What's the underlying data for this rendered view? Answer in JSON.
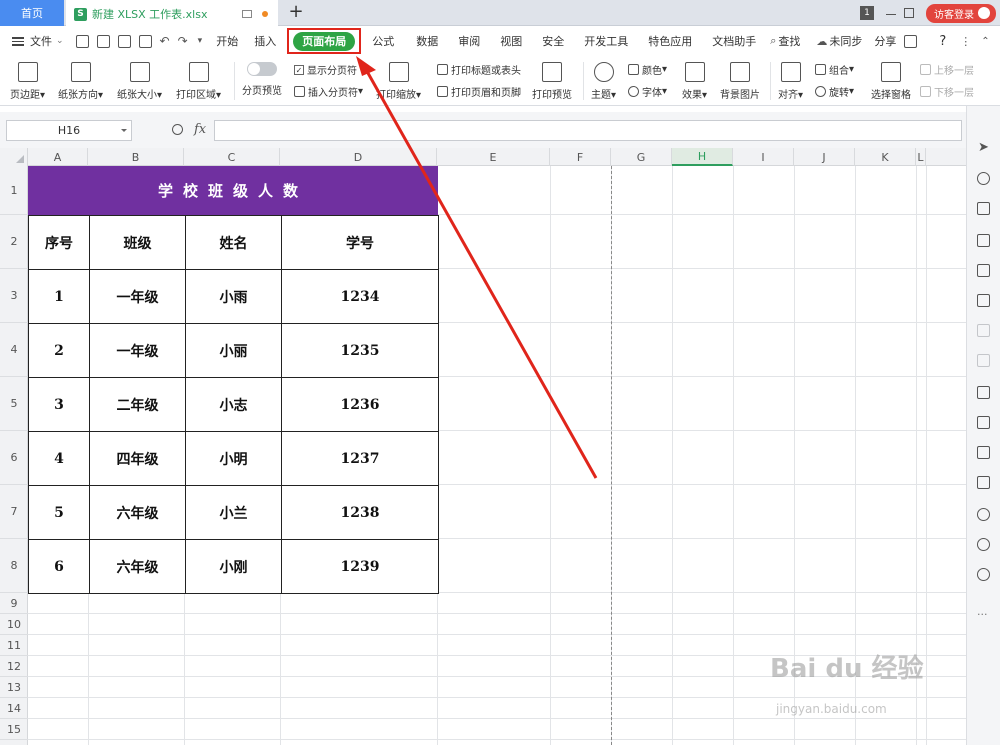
{
  "tabs": {
    "home": "首页",
    "file_icon": "S",
    "file_name": "新建 XLSX 工作表.xlsx",
    "add": "+",
    "window_count": "1",
    "login": "访客登录"
  },
  "menu": {
    "file": "文件",
    "items": [
      "开始",
      "插入",
      "页面布局",
      "公式",
      "数据",
      "审阅",
      "视图",
      "安全",
      "开发工具",
      "特色应用",
      "文档助手"
    ],
    "active": "页面布局",
    "search": "查找",
    "sync": "未同步",
    "share": "分享",
    "help": "?"
  },
  "ribbon": {
    "margins": "页边距",
    "orientation": "纸张方向",
    "size": "纸张大小",
    "print_area": "打印区域",
    "page_break_preview": "分页预览",
    "show_page_break": "显示分页符",
    "insert_page_break": "插入分页符",
    "print_scaling": "打印缩放",
    "print_titles": "打印标题或表头",
    "print_header_footer": "打印页眉和页脚",
    "print_preview": "打印预览",
    "theme": "主题",
    "colors": "颜色",
    "fonts": "字体",
    "effects": "效果",
    "background": "背景图片",
    "align": "对齐",
    "group": "组合",
    "rotate": "旋转",
    "selection_pane": "选择窗格",
    "bring_forward": "上移一层",
    "send_backward": "下移一层"
  },
  "formula": {
    "cell_ref": "H16",
    "fx": "fx",
    "value": ""
  },
  "columns": [
    "A",
    "B",
    "C",
    "D",
    "E",
    "F",
    "G",
    "H",
    "I",
    "J",
    "K",
    "L"
  ],
  "selected_column": "H",
  "rows": [
    "1",
    "2",
    "3",
    "4",
    "5",
    "6",
    "7",
    "8",
    "9",
    "10",
    "11",
    "12",
    "13",
    "14",
    "15"
  ],
  "table": {
    "title": "学校班级人数",
    "headers": [
      "序号",
      "班级",
      "姓名",
      "学号"
    ],
    "rows": [
      [
        "1",
        "一年级",
        "小雨",
        "1234"
      ],
      [
        "2",
        "一年级",
        "小丽",
        "1235"
      ],
      [
        "3",
        "二年级",
        "小志",
        "1236"
      ],
      [
        "4",
        "四年级",
        "小明",
        "1237"
      ],
      [
        "5",
        "六年级",
        "小兰",
        "1238"
      ],
      [
        "6",
        "六年级",
        "小刚",
        "1239"
      ]
    ],
    "title_color": "#7030a0"
  },
  "colors": {
    "accent": "#2ea444",
    "home_tab": "#4a8cf0",
    "highlight_box": "#e0251b",
    "login": "#e2443d"
  },
  "watermark": {
    "brand": "Bai du 经验",
    "url": "jingyan.baidu.com"
  }
}
